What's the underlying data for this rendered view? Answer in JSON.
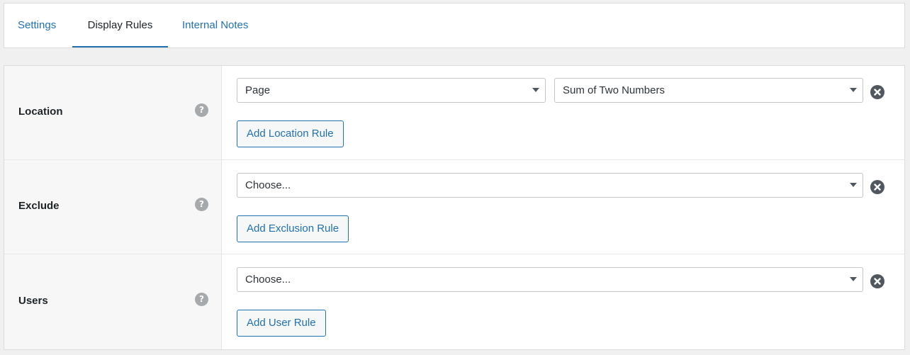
{
  "tabs": {
    "settings": "Settings",
    "display_rules": "Display Rules",
    "internal_notes": "Internal Notes"
  },
  "rules": {
    "location": {
      "label": "Location",
      "help": "?",
      "select_type": "Page",
      "select_value": "Sum of Two Numbers",
      "add_button": "Add Location Rule"
    },
    "exclude": {
      "label": "Exclude",
      "help": "?",
      "select_value": "Choose...",
      "add_button": "Add Exclusion Rule"
    },
    "users": {
      "label": "Users",
      "help": "?",
      "select_value": "Choose...",
      "add_button": "Add User Rule"
    }
  },
  "colors": {
    "accent": "#2271b1",
    "background": "#f0f0f1",
    "label_column": "#f7f7f7",
    "remove_icon": "#50575e",
    "help_icon": "#a7aaad"
  }
}
